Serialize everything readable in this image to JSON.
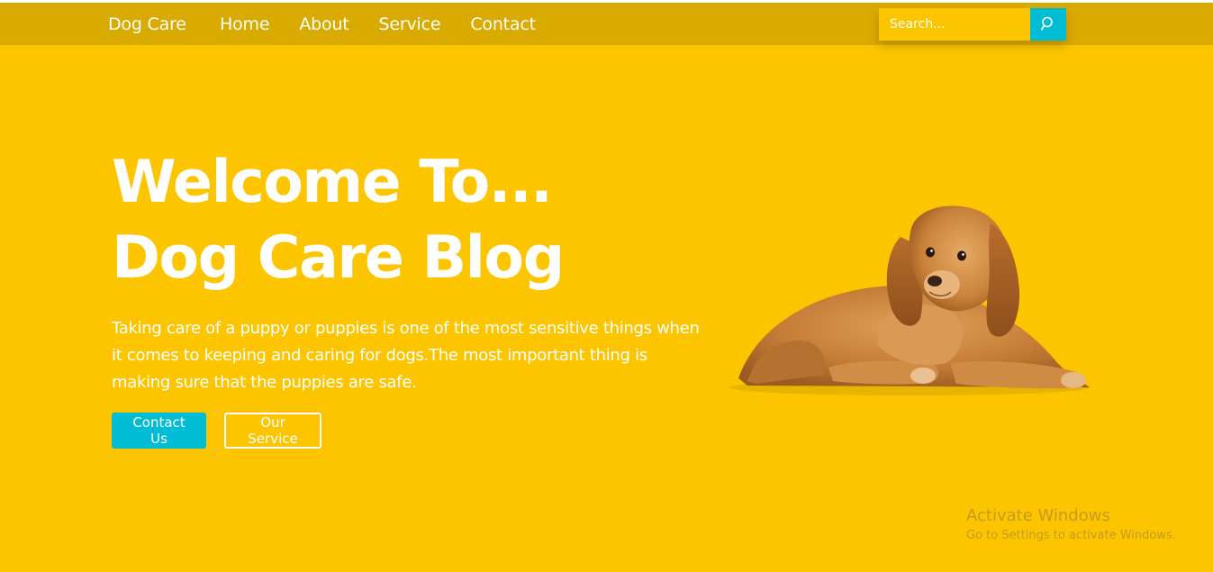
{
  "navbar": {
    "brand": "Dog Care",
    "links": [
      "Home",
      "About",
      "Service",
      "Contact"
    ],
    "search": {
      "placeholder": "Search...",
      "button_icon": "search-icon"
    }
  },
  "hero": {
    "title_line1": "Welcome To...",
    "title_line2": "Dog Care Blog",
    "description": "Taking care of a puppy or puppies is one of the most sensitive things when it comes to keeping and caring for dogs.The most important thing is making sure that the puppies are safe.",
    "primary_button": "Contact Us",
    "secondary_button": "Our Service",
    "image": "puppy-image"
  },
  "watermark": {
    "title": "Activate Windows",
    "subtitle": "Go to Settings to activate Windows."
  },
  "colors": {
    "background": "#fcc500",
    "navbar": "#d9aa00",
    "accent": "#00bcd4",
    "text": "#ffffff"
  }
}
